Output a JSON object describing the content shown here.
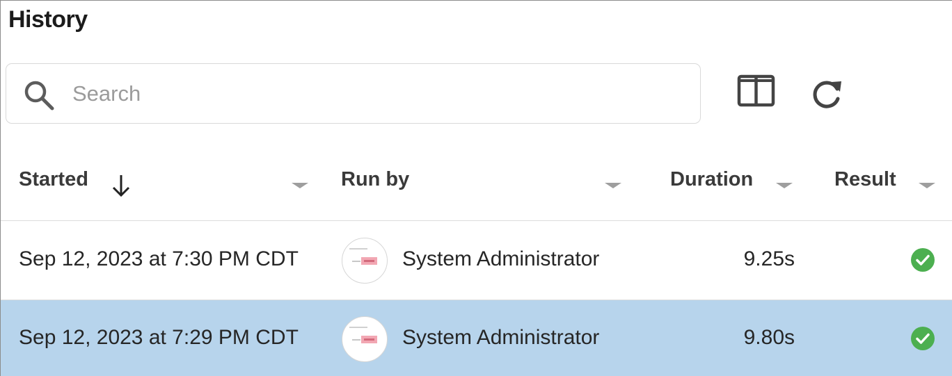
{
  "panel": {
    "title": "History"
  },
  "search": {
    "placeholder": "Search",
    "value": ""
  },
  "toolbar": {
    "columns_icon": "columns-icon",
    "refresh_icon": "refresh-icon"
  },
  "table": {
    "columns": [
      {
        "label": "Started",
        "sort": "descending"
      },
      {
        "label": "Run by"
      },
      {
        "label": "Duration"
      },
      {
        "label": "Result"
      }
    ],
    "rows": [
      {
        "started": "Sep 12, 2023 at 7:30 PM CDT",
        "run_by": "System Administrator",
        "duration": "9.25s",
        "result": "success",
        "selected": false
      },
      {
        "started": "Sep 12, 2023 at 7:29 PM CDT",
        "run_by": "System Administrator",
        "duration": "9.80s",
        "result": "success",
        "selected": true
      }
    ]
  },
  "colors": {
    "selected_row": "#b7d4ec",
    "success": "#4caf50",
    "header_text": "#3a3a3a"
  }
}
